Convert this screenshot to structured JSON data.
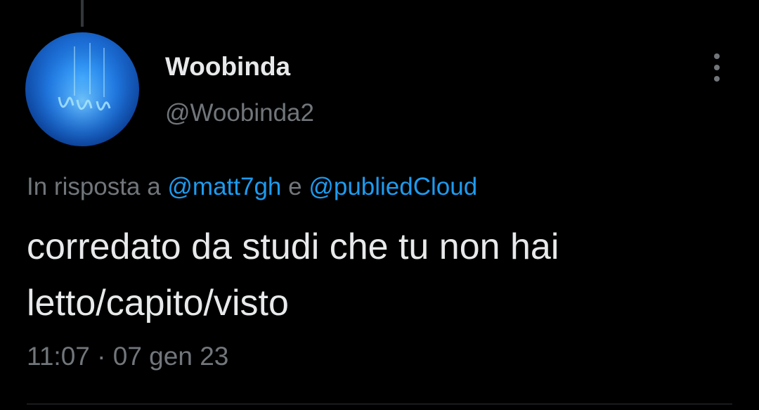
{
  "tweet": {
    "author": {
      "display_name": "Woobinda",
      "handle": "@Woobinda2"
    },
    "reply_to": {
      "prefix": "In risposta a",
      "users": [
        "@matt7gh",
        "@publiedCloud"
      ],
      "conjunction": "e"
    },
    "text_lines": [
      "corredato da studi che tu non hai",
      "letto/capito/visto"
    ],
    "time": "11:07",
    "separator": "·",
    "date": "07 gen 23"
  },
  "icons": {
    "more": "more-vertical-icon"
  },
  "colors": {
    "background": "#000000",
    "primary_text": "#e7e9ea",
    "secondary_text": "#71767b",
    "link": "#1d9bf0",
    "divider": "#2f3336"
  }
}
